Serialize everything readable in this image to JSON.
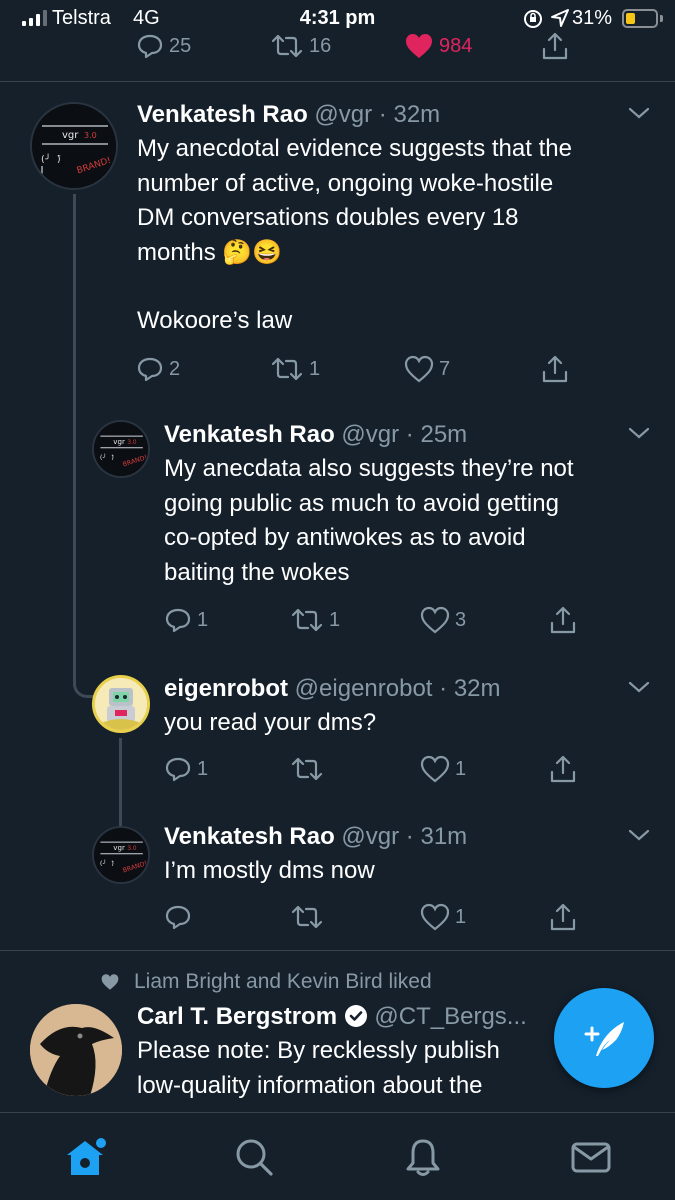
{
  "status_bar": {
    "carrier": "Telstra",
    "network": "4G",
    "time": "4:31 pm",
    "battery": "31%",
    "battery_level": 0.31,
    "battery_color": "#f5c518"
  },
  "top_actions": {
    "replies": "25",
    "retweets": "16",
    "likes": "984",
    "like_color": "#e0245e",
    "liked": true
  },
  "tweets": [
    {
      "name": "Venkatesh Rao",
      "handle": "@vgr",
      "time": "32m",
      "text_lines": [
        "My anecdotal evidence suggests that the",
        "number of active, ongoing woke-hostile",
        "DM conversations doubles every 18",
        "months 🤔😆"
      ],
      "text_lines_2": [
        "Wokoore’s law"
      ],
      "replies": "2",
      "retweets": "1",
      "likes": "7",
      "avatar_text": "vgr",
      "avatar_badge": "3.0",
      "avatar_tag": "BRAND!"
    },
    {
      "name": "Venkatesh Rao",
      "handle": "@vgr",
      "time": "25m",
      "text_lines": [
        "My anecdata also suggests they’re not",
        "going public as much to avoid getting",
        "co-opted by antiwokes as to avoid",
        "baiting the wokes"
      ],
      "replies": "1",
      "retweets": "1",
      "likes": "3",
      "avatar_text": "vgr",
      "avatar_badge": "3.0",
      "avatar_tag": "BRAND!"
    },
    {
      "name": "eigenrobot",
      "handle": "@eigenrobot",
      "time": "32m",
      "text_lines": [
        "you read your dms?"
      ],
      "replies": "1",
      "retweets": "",
      "likes": "1"
    },
    {
      "name": "Venkatesh Rao",
      "handle": "@vgr",
      "time": "31m",
      "text_lines": [
        "I’m mostly dms now"
      ],
      "replies": "",
      "retweets": "",
      "likes": "1",
      "avatar_text": "vgr",
      "avatar_badge": "3.0",
      "avatar_tag": "BRAND!"
    },
    {
      "social_context": "Liam Bright and Kevin Bird liked",
      "name": "Carl T. Bergstrom",
      "handle": "@CT_Bergs...",
      "verified": true,
      "text_lines": [
        "Please note: By recklessly publish",
        "low-quality information about the"
      ]
    }
  ],
  "separator": "·",
  "colors": {
    "background": "#15202b",
    "accent": "#1da1f2",
    "secondary_text": "#8899a6",
    "divider": "#38444d"
  },
  "bottom_nav": {
    "items": [
      {
        "icon": "home-icon",
        "active": true
      },
      {
        "icon": "search-icon",
        "active": false
      },
      {
        "icon": "bell-icon",
        "active": false
      },
      {
        "icon": "mail-icon",
        "active": false
      }
    ],
    "has_notification_dot": true
  },
  "fab": {
    "icon": "compose-feather-icon"
  }
}
